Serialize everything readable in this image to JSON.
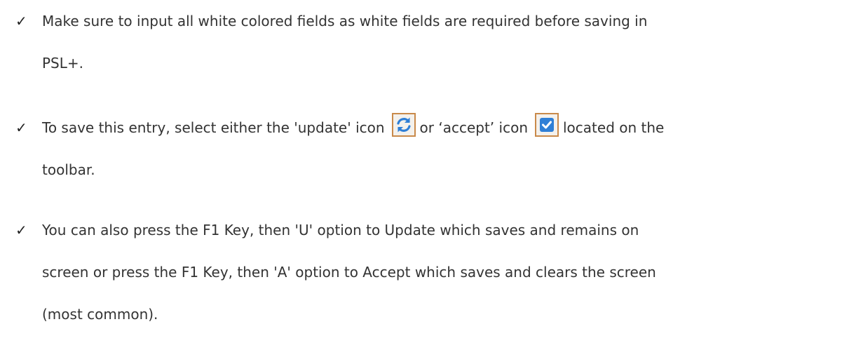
{
  "bullets": [
    {
      "check": "✓",
      "lines": [
        "Make sure to input all white colored fields as white fields are required before saving in",
        "PSL+."
      ]
    },
    {
      "check": "✓",
      "part1": "To save this entry, select either the 'update' icon",
      "part2": "or ‘accept’ icon",
      "part3": "located on the",
      "line2": "toolbar.",
      "icons": {
        "update": "refresh-icon",
        "accept": "checkbox-icon"
      },
      "colors": {
        "icon_border": "#c98a4a",
        "update_icon": "#2f7fd6",
        "accept_icon": "#2f7fd6"
      }
    },
    {
      "check": "✓",
      "lines": [
        "You can also press the F1 Key, then 'U' option to Update which saves and remains on",
        "screen or press the F1 Key, then 'A' option to Accept which saves and clears the screen",
        "(most common)."
      ]
    }
  ]
}
